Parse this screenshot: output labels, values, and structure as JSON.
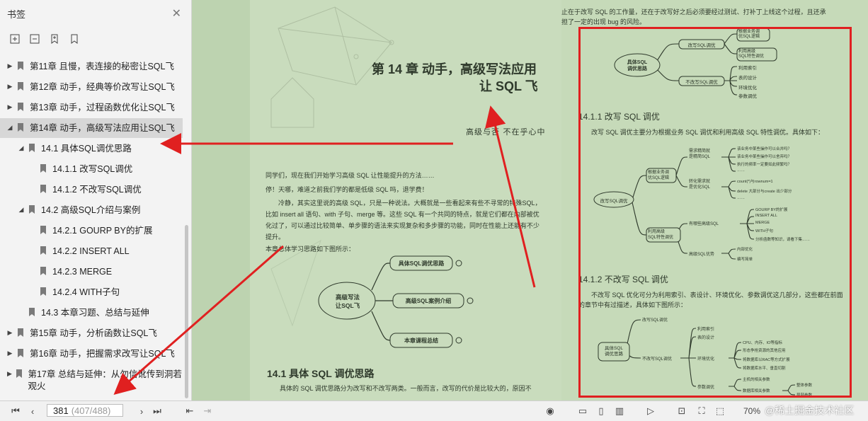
{
  "sidebar": {
    "title": "书签",
    "toc": [
      {
        "label": "第11章 且慢，表连接的秘密让SQL飞",
        "level": 0,
        "expander": "▶",
        "selected": false
      },
      {
        "label": "第12章 动手，经典等价改写让SQL飞",
        "level": 0,
        "expander": "▶",
        "selected": false
      },
      {
        "label": "第13章 动手，过程函数优化让SQL飞",
        "level": 0,
        "expander": "▶",
        "selected": false
      },
      {
        "label": "第14章 动手，高级写法应用让SQL飞",
        "level": 0,
        "expander": "◢",
        "selected": true
      },
      {
        "label": "14.1 具体SQL调优思路",
        "level": 1,
        "expander": "◢",
        "selected": false
      },
      {
        "label": "14.1.1 改写SQL调优",
        "level": 2,
        "expander": "",
        "selected": false
      },
      {
        "label": "14.1.2 不改写SQL调优",
        "level": 2,
        "expander": "",
        "selected": false
      },
      {
        "label": "14.2 高级SQL介绍与案例",
        "level": 1,
        "expander": "◢",
        "selected": false
      },
      {
        "label": "14.2.1 GOURP BY的扩展",
        "level": 2,
        "expander": "",
        "selected": false
      },
      {
        "label": "14.2.2 INSERT ALL",
        "level": 2,
        "expander": "",
        "selected": false
      },
      {
        "label": "14.2.3 MERGE",
        "level": 2,
        "expander": "",
        "selected": false
      },
      {
        "label": "14.2.4 WITH子句",
        "level": 2,
        "expander": "",
        "selected": false
      },
      {
        "label": "14.3 本章习题、总结与延伸",
        "level": 1,
        "expander": "",
        "selected": false
      },
      {
        "label": "第15章 动手，分析函数让SQL飞",
        "level": 0,
        "expander": "▶",
        "selected": false
      },
      {
        "label": "第16章 动手，把握需求改写让SQL飞",
        "level": 0,
        "expander": "▶",
        "selected": false
      },
      {
        "label": "第17章 总结与延伸：从勿信讹传到洞若观火",
        "level": 0,
        "expander": "▶",
        "selected": false
      }
    ]
  },
  "pageL": {
    "chapter": "第 14 章   动手，高级写法应用",
    "chapter2": "让 SQL 飞",
    "motto": "高级与否 不在乎心中",
    "p1": "同学们，现在我们开始学习高级 SQL 让性能提升的方法……",
    "p2": "停！天哪，难道之前我们学的都是低级 SQL 吗，退学费！",
    "p3": "冷静，其实这里说的高级 SQL，只是一种说法。大概就是一些看起来有些不寻常的特殊SQL，比如 insert all 语句、with 子句、merge 等。这些 SQL 有一个共同的特点，就是它们都在内部被优化过了，可以通过比较简单、单步骤的语法来实现复杂和多步骤的功能，同时在性能上还能有不少提升。",
    "p4": "本章总体学习思路如下图所示：",
    "mm_center": "高级写法\n让SQL飞",
    "mm1": "具体SQL调优思路",
    "mm2": "高级SQL案例介绍",
    "mm3": "本章课程总结",
    "sec": "14.1   具体 SQL 调优思路",
    "p5": "具体的 SQL 调优思路分为改写和不改写两类。一般而言，改写的代价是比较大的，原因不"
  },
  "pageR": {
    "top1": "止在于改写 SQL 的工作量，还在于改写好之后必须要经过测试、打补丁上线这个过程，且还承",
    "top2": "担了一定的出现 bug 的风险。",
    "mm_a_center": "具体SQL\n调优思路",
    "mm_a1": "改写SQL调优",
    "mm_a2": "不改写SQL调优",
    "mm_a3": "根据业务调\n优SQL逻辑",
    "mm_a4": "利用高级\nSQL特性调优",
    "mm_a5": "利用索引",
    "mm_a6": "表的设计",
    "mm_a7": "环境优化",
    "mm_a8": "参数调优",
    "h1": "14.1.1   改写 SQL 调优",
    "p1": "改写 SQL 调优主要分为根据业务 SQL 调优和利用高级 SQL 特性调优。具体如下：",
    "mm_b_center": "改写SQL调优",
    "mm_b1": "根据业务调\n优SQL逻辑",
    "mm_b2": "利用高级\nSQL特性调优",
    "mm_b3": "需求精简就\n是精简SQL",
    "mm_b4": "转化需求就\n是优化SQL",
    "mm_b5": "有哪些高级SQL",
    "mm_b6": "高级SQL优势",
    "mm_b7": "该业务中某些操作可以合并吗？",
    "mm_b8": "该业务中某些操作可以舍弃吗？",
    "mm_b9": "执行的频率一定要如此频繁吗？",
    "mm_b10": "……",
    "mm_b11": "count(*)与rownum=1",
    "mm_b12": "delete 大部分与create 出少部分",
    "mm_b13": "……",
    "mm_b14": "GOURP BY的扩展",
    "mm_b15": "INSERT ALL",
    "mm_b16": "MERGE",
    "mm_b17": "WITH子句",
    "mm_b18": "分析函数等知识，请看下集……",
    "mm_b19": "内部优化",
    "mm_b20": "编写简单",
    "h2": "14.1.2   不改写 SQL 调优",
    "p2": "不改写 SQL 优化可分为利用索引、表设计、环境优化、参数调优这几部分，这些都在前面",
    "p3": "的章节中有过描述，具体如下图所示：",
    "mm_c_center": "具体SQL\n调优思路",
    "mm_c1": "改写SQL调优",
    "mm_c2": "不改写SQL调优",
    "mm_c3": "利用索引",
    "mm_c4": "表的设计",
    "mm_c5": "环境优化",
    "mm_c6": "参数调优",
    "mm_c7": "CPU、内存、IO等指标",
    "mm_c8": "形态争抢资源的其他应用",
    "mm_c9": "将数据库以RAC等方式扩展",
    "mm_c10": "将数据库水平、垂直切割",
    "mm_c11": "主机的相关参数",
    "mm_c12": "数据库相关参数",
    "mm_c13": "整体参数",
    "mm_c14": "局部参数"
  },
  "bar": {
    "page_current": "381",
    "page_total": "(407/488)",
    "zoom": "70%",
    "watermark": "@稀土掘金技术社区"
  },
  "colors": {
    "highlight": "#e02020",
    "page": "#c9dcbd",
    "sidebar_sel": "#d7d7d7"
  }
}
